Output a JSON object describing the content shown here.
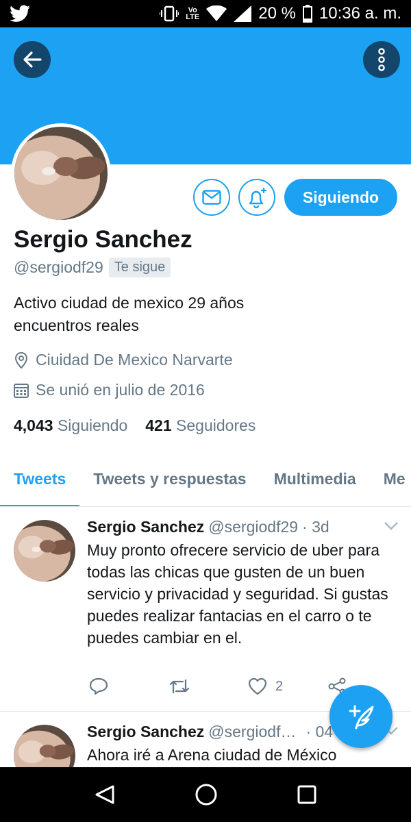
{
  "status_bar": {
    "volte_top": "Vo",
    "volte_bottom": "LTE",
    "battery": "20 %",
    "time": "10:36 a. m."
  },
  "profile": {
    "name": "Sergio Sanchez",
    "handle": "@sergiodf29",
    "follows_you": "Te sigue",
    "bio_line1": "Activo ciudad de mexico 29 años",
    "bio_line2": "encuentros reales",
    "location": "Ciuidad De Mexico Narvarte",
    "joined": "Se unió en julio de 2016",
    "following_count": "4,043",
    "following_label": "Siguiendo",
    "followers_count": "421",
    "followers_label": "Seguidores",
    "follow_button": "Siguiendo"
  },
  "tabs": [
    {
      "label": "Tweets",
      "active": true
    },
    {
      "label": "Tweets y respuestas",
      "active": false
    },
    {
      "label": "Multimedia",
      "active": false
    },
    {
      "label": "Me",
      "active": false
    }
  ],
  "tweets": [
    {
      "name": "Sergio Sanchez",
      "handle": "@sergiodf29",
      "time": "· 3d",
      "text": "Muy pronto ofrecere servicio de uber para todas las chicas que gusten de un buen servicio y privacidad y seguridad. Si gustas puedes realizar fantacias en el carro o te puedes cambiar en el.",
      "likes": "2"
    },
    {
      "name": "Sergio Sanchez",
      "handle": "@sergiodf…",
      "time": "· 04",
      "text": "Ahora iré a Arena ciudad de México"
    }
  ],
  "colors": {
    "accent": "#1da1f2",
    "dark_button": "#14456b",
    "muted_text": "#657786"
  }
}
